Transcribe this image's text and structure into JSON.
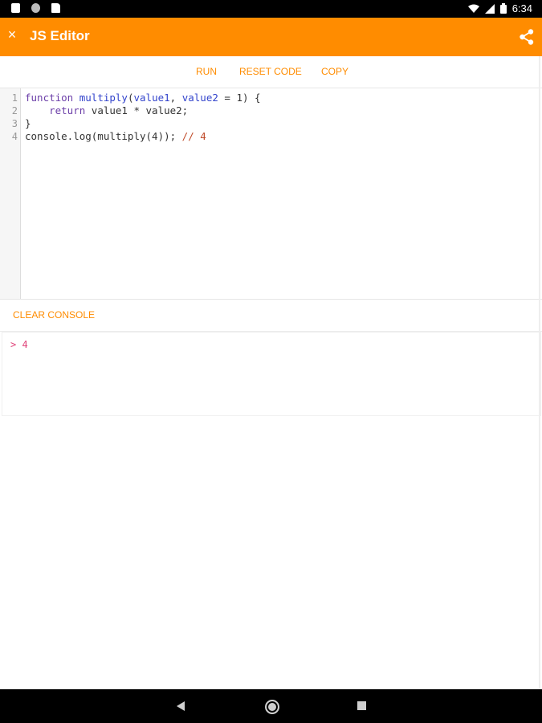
{
  "status_bar": {
    "time": "6:34"
  },
  "app_bar": {
    "title": "JS Editor",
    "close_icon": "close-icon",
    "share_icon": "share-icon",
    "color": "#ff8c00"
  },
  "toolbar": {
    "run_label": "RUN",
    "reset_label": "RESET CODE",
    "copy_label": "COPY"
  },
  "editor": {
    "line_numbers": [
      "1",
      "2",
      "3",
      "4"
    ],
    "lines": [
      "function multiply(value1, value2 = 1) {",
      "    return value1 * value2;",
      "}",
      "console.log(multiply(4)); // 4"
    ]
  },
  "console": {
    "clear_label": "CLEAR CONSOLE",
    "output": [
      "> 4"
    ]
  }
}
